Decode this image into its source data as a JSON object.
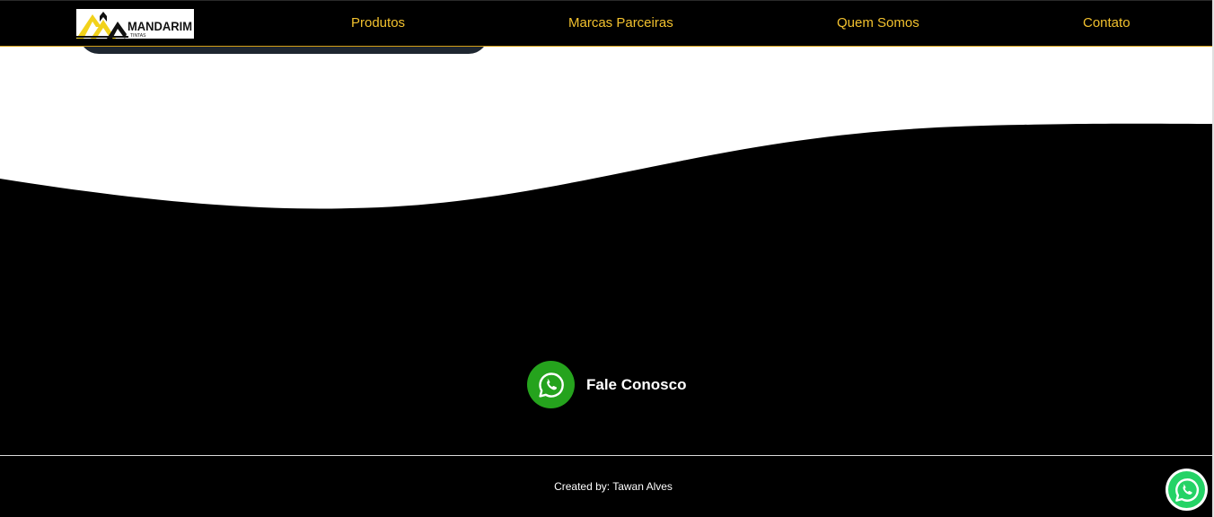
{
  "navbar": {
    "logo": {
      "brand": "MANDARIM",
      "subtitle": "TINTAS"
    },
    "links": [
      {
        "label": "Produtos"
      },
      {
        "label": "Marcas Parceiras"
      },
      {
        "label": "Quem Somos"
      },
      {
        "label": "Contato"
      }
    ]
  },
  "contact": {
    "label": "Fale Conosco",
    "icon": "whatsapp-icon"
  },
  "footer": {
    "credits": "Created by: Tawan Alves"
  },
  "floating_button": {
    "icon": "whatsapp-icon"
  },
  "colors": {
    "nav_background": "#000000",
    "nav_link": "#f2c12e",
    "logo_accent": "#f2d21b",
    "whatsapp_green": "#25a31d",
    "whatsapp_float_green": "#25d366",
    "footer_text": "#ffffff"
  }
}
